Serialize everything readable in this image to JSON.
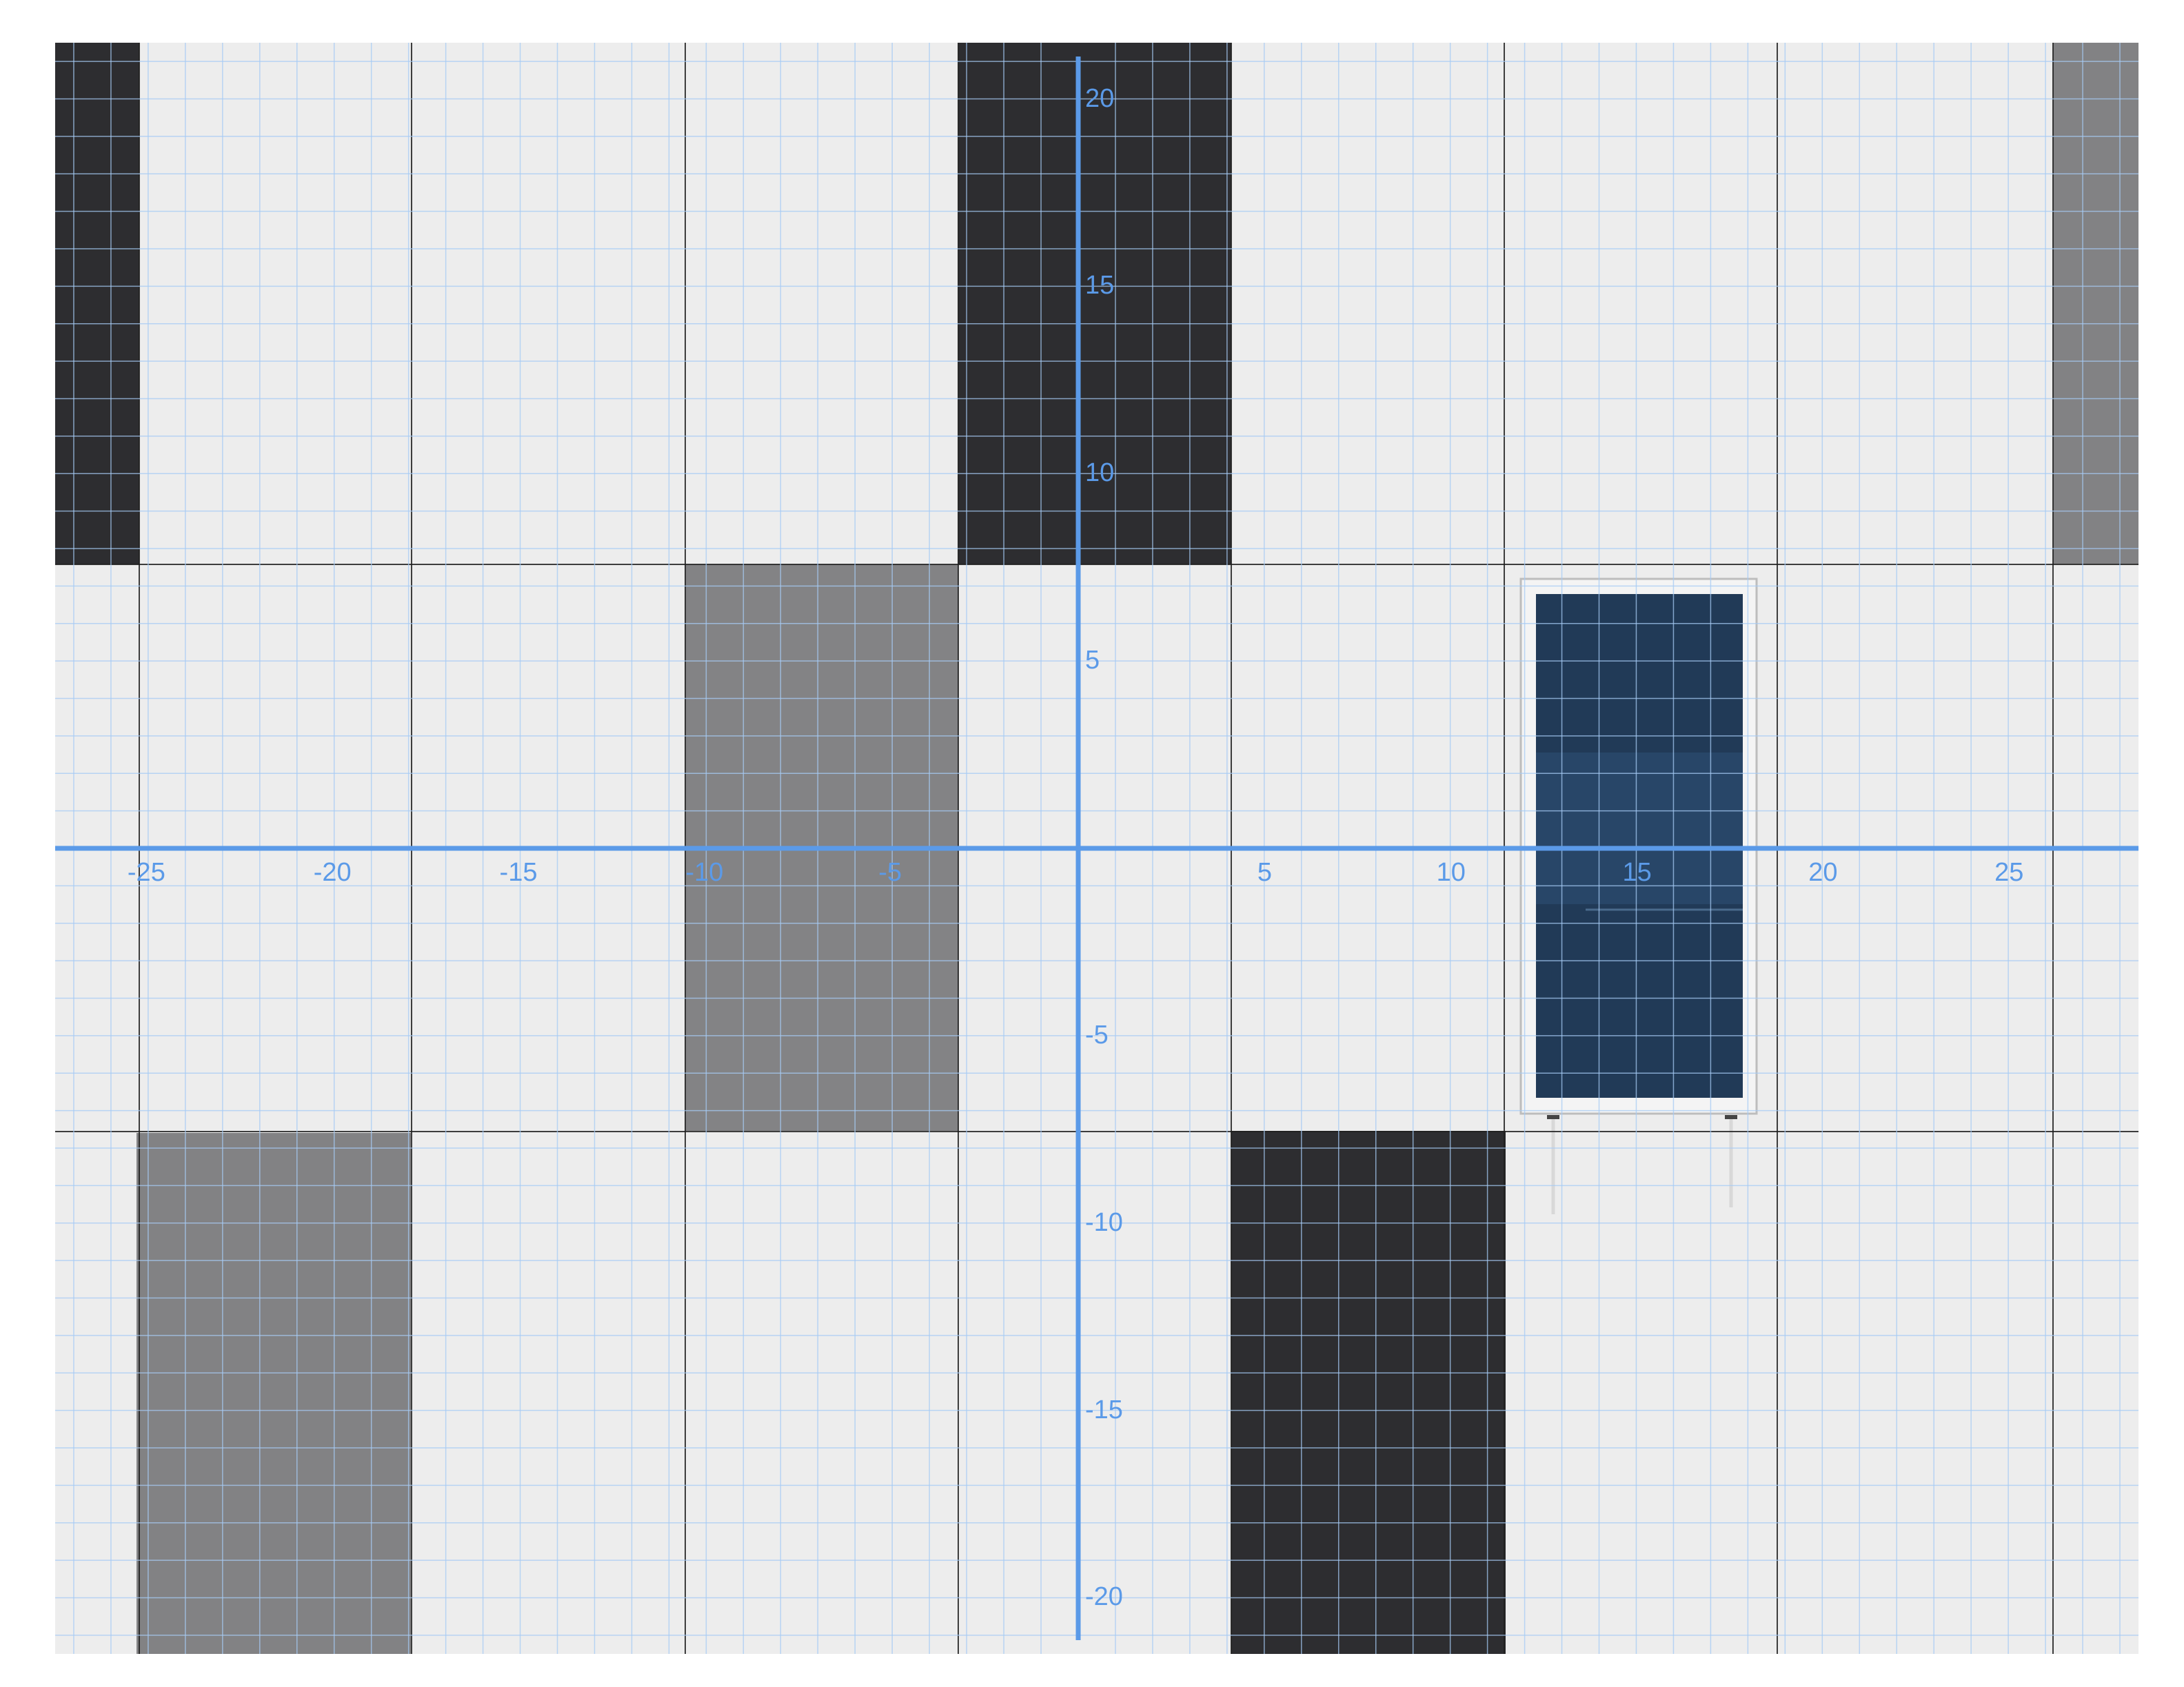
{
  "scene": {
    "description": "photo",
    "colors": {
      "panel_white": "#ededed",
      "panel_grey": "#828284",
      "panel_dark": "#2d2d30",
      "window_glass": "#213a57",
      "window_frame": "#f4f4f4",
      "seam": "#1f1f1f",
      "grid_minor": "#a6cbf5",
      "axis": "#5b9ae8"
    }
  },
  "overlay": {
    "x_ticks": [
      "-25",
      "-20",
      "-15",
      "-10",
      "-5",
      "5",
      "10",
      "15",
      "20",
      "25"
    ],
    "y_ticks": [
      "20",
      "15",
      "10",
      "5",
      "-5",
      "-10",
      "-15",
      "-20"
    ],
    "x_range": [
      -27.5,
      28.5
    ],
    "y_range": [
      -21.5,
      21.5
    ]
  },
  "icons": {
    "window": "rectangle-icon"
  }
}
